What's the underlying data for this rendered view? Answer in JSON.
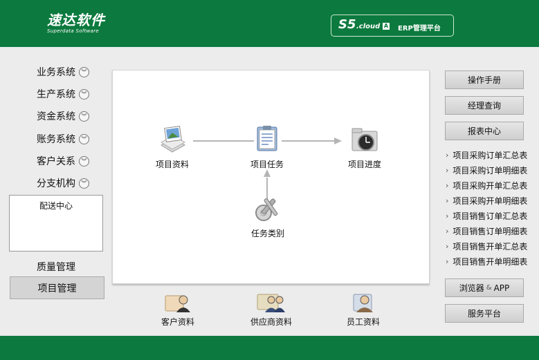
{
  "header": {
    "logo_cn": "速达软件",
    "logo_en": "Superdata Software",
    "badge_s5": "S5",
    "badge_cloud": ".cloud",
    "badge_a": "A",
    "badge_erp": "ERP管理平台"
  },
  "sidebar": {
    "items": [
      {
        "label": "业务系统"
      },
      {
        "label": "生产系统"
      },
      {
        "label": "资金系统"
      },
      {
        "label": "账务系统"
      },
      {
        "label": "客户关系"
      },
      {
        "label": "分支机构"
      }
    ],
    "branch_entries": [
      "配送中心"
    ],
    "quality": "质量管理",
    "project": "项目管理"
  },
  "flow": {
    "nodes": [
      {
        "label": "项目资料",
        "icon": "photo-album-icon"
      },
      {
        "label": "项目任务",
        "icon": "clipboard-icon"
      },
      {
        "label": "项目进度",
        "icon": "clock-folder-icon"
      },
      {
        "label": "任务类别",
        "icon": "tools-gear-icon"
      }
    ]
  },
  "bottom": {
    "items": [
      {
        "label": "客户资料",
        "icon": "customer-icon"
      },
      {
        "label": "供应商资料",
        "icon": "supplier-icon"
      },
      {
        "label": "员工资料",
        "icon": "employee-icon"
      }
    ]
  },
  "right": {
    "manual": "操作手册",
    "manager": "经理查询",
    "reports_center": "报表中心",
    "reports": [
      "项目采购订单汇总表",
      "项目采购订单明细表",
      "项目采购开单汇总表",
      "项目采购开单明细表",
      "项目销售订单汇总表",
      "项目销售订单明细表",
      "项目销售开单汇总表",
      "项目销售开单明细表"
    ],
    "browser_a": "浏览器",
    "browser_amp": "&",
    "browser_b": "APP",
    "service": "服务平台"
  },
  "colors": {
    "brand": "#0c7a3e"
  }
}
